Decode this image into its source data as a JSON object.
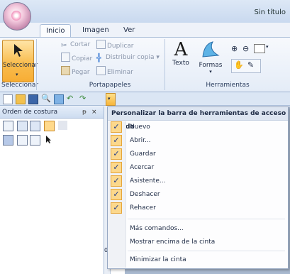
{
  "window": {
    "title": "Sin título"
  },
  "tabs": [
    {
      "label": "Inicio",
      "active": true
    },
    {
      "label": "Imagen",
      "active": false
    },
    {
      "label": "Ver",
      "active": false
    }
  ],
  "ribbon": {
    "seleccionar_group": {
      "button_label": "Seleccionar",
      "group_label": "Seleccionar"
    },
    "portapapeles": {
      "group_label": "Portapapeles",
      "items": {
        "cortar": "Cortar",
        "duplicar": "Duplicar",
        "copiar": "Copiar",
        "distribuir_copia": "Distribuir copia",
        "pegar": "Pegar",
        "eliminar": "Eliminar"
      }
    },
    "herramientas": {
      "group_label": "Herramientas",
      "texto": "Texto",
      "formas": "Formas"
    }
  },
  "panel": {
    "title": "Orden de costura",
    "pin": "ꟸ",
    "close": "×"
  },
  "menu": {
    "header": "Personalizar la barra de herramientas de acceso rápido",
    "items": [
      {
        "label": "Nuevo",
        "checked": true
      },
      {
        "label": "Abrir...",
        "checked": true
      },
      {
        "label": "Guardar",
        "checked": true
      },
      {
        "label": "Acercar",
        "checked": true
      },
      {
        "label": "Asistente...",
        "checked": true
      },
      {
        "label": "Deshacer",
        "checked": true
      },
      {
        "label": "Rehacer",
        "checked": true
      }
    ],
    "extra": [
      "Más comandos...",
      "Mostrar encima de la cinta"
    ],
    "last": "Minimizar la cinta"
  },
  "ruler_mark": "0",
  "colors": {
    "accent": "#f9bd4f",
    "check_bg": "#fcd88c",
    "ribbon_bg": "#e4ecf7"
  }
}
